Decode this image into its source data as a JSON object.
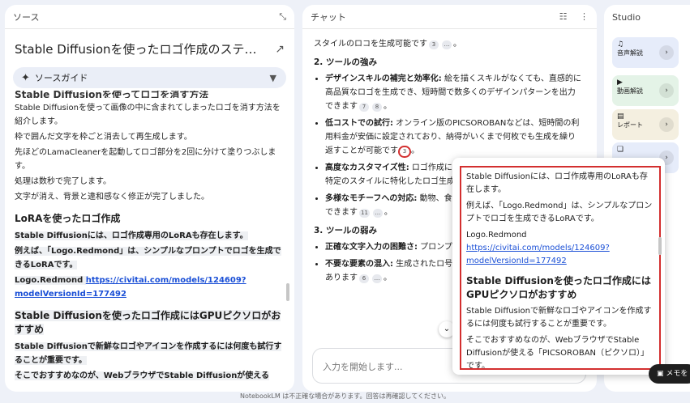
{
  "source": {
    "panel_title": "ソース",
    "doc_title": "Stable Diffusionを使ったロゴ作成のステップガ...",
    "guide_label": "ソースガイド",
    "cut_heading": "Stable Diffusionを使ってロゴを消す方法",
    "paragraphs": [
      "Stable Diffusionを使って画像の中に含まれてしまったロゴを消す方法を紹介します。",
      "枠で囲んだ文字を枠ごと消去して再生成します。",
      "先ほどのLamaCleanerを起動してロゴ部分を2回に分けて塗りつぶします。",
      "処理は数秒で完了します。",
      "文字が消え、背景と違和感なく修正が完了しました。"
    ],
    "lora_heading": "LoRAを使ったロゴ作成",
    "lora_p1": "Stable Diffusionには、ロゴ作成専用のLoRAも存在します。",
    "lora_p2": "例えば、「Logo.Redmond」は、シンプルなプロンプトでロゴを生成できるLoRAです。",
    "lora_name": "Logo.Redmond ",
    "lora_link": "https://civitai.com/models/124609?modelVersionId=177492",
    "gpu_heading": "Stable Diffusionを使ったロゴ作成にはGPUピクソロがおすすめ",
    "gpu_p1": "Stable Diffusionで新鮮なロゴやアイコンを作成するには何度も試行することが重要です。",
    "gpu_p2": "そこでおすすめなのが、WebブラウザでStable Diffusionが使える"
  },
  "chat": {
    "panel_title": "チャット",
    "intro_line": "スタイルのロコを生成可能です",
    "intro_cite": "3",
    "section2": "2. ツールの強み",
    "strengths": [
      {
        "key": "デザインスキルの補完と効率化:",
        "text": " 絵を描くスキルがなくても、直感的に高品質なロゴを生成でき、短時間で数多くのデザインパターンを出力できます",
        "cites": [
          "7",
          "8"
        ]
      },
      {
        "key": "低コストでの試行:",
        "text": " オンライン版のPICSOROBANなどは、短時間の利用料金が安価に設定されており、納得がいくまで何枚でも生成を繰り返すことが可能です",
        "cites": [
          "3"
        ]
      },
      {
        "key": "高度なカスタマイズ性:",
        "text": " ロゴ作成に（LoRA）を導入することで、クー特定のスタイルに特化したロゴ生成ます",
        "cites": [
          "6"
        ]
      },
      {
        "key": "多様なモチーフへの対応:",
        "text": " 動物、食系など、プロンプト次第であらゆ成できます",
        "cites": [
          "11"
        ]
      }
    ],
    "section3": "3. ツールの弱み",
    "weaknesses": [
      {
        "key": "正確な文字入力の困難さ:",
        "text": " プロンプの中に正確に入れることは不可能",
        "cites": []
      },
      {
        "key": "不要な要素の混入:",
        "text": " 生成されたロ号（サイン）、ウォーターマークとがあります",
        "cites": [
          "6"
        ]
      }
    ],
    "input_placeholder": "入力を開始します..."
  },
  "popover": {
    "p1": "Stable Diffusionには、ロゴ作成専用のLoRAも存在します。",
    "p2": "例えば、「Logo.Redmond」は、シンプルなプロンプトでロゴを生成できるLoRAです。",
    "name": "Logo.Redmond",
    "link": "https://civitai.com/models/124609?modelVersionId=177492",
    "heading": "Stable Diffusionを使ったロゴ作成にはGPUピクソロがおすすめ",
    "p3": "Stable Diffusionで新鮮なロゴやアイコンを作成するには何度も試行することが重要です。",
    "p4": "そこでおすすめなのが、WebブラウザでStable Diffusionが使える「PICSOROBAN（ピクソロ）」です。"
  },
  "studio": {
    "panel_title": "Studio",
    "cards": [
      {
        "label": "音声解説",
        "color": "#e6ecfa"
      },
      {
        "label": "動画解説",
        "color": "#e4f3e7"
      },
      {
        "label": "レポート",
        "color": "#f4efe0"
      },
      {
        "label": "",
        "color": "#e6ecfa"
      }
    ],
    "memo_label": "メモを"
  },
  "footer": "NotebookLM は不正確な場合があります。回答は再確認してください。"
}
